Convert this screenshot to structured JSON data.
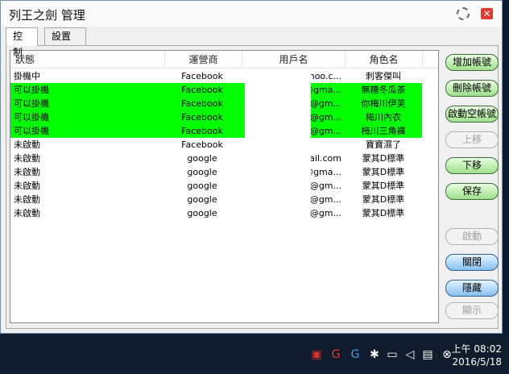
{
  "window": {
    "title": "列王之劍 管理"
  },
  "icons": {
    "settings": "gear-icon",
    "close": "close-icon"
  },
  "tabs": [
    {
      "label": "控制",
      "active": true
    },
    {
      "label": "設置",
      "active": false
    }
  ],
  "table": {
    "columns": [
      "狀態",
      "運營商",
      "用戶名",
      "角色名"
    ],
    "rows": [
      {
        "status": "掛機中",
        "provider": "Facebook",
        "user": "hoo.c...",
        "role": "刺客傑叫",
        "highlight": false
      },
      {
        "status": "可以掛機",
        "provider": "Facebook",
        "user": "@gma...",
        "role": "無糖冬瓜茶",
        "highlight": true
      },
      {
        "status": "可以掛機",
        "provider": "Facebook",
        "user": "@gm...",
        "role": "你梅川伊芙",
        "highlight": true
      },
      {
        "status": "可以掛機",
        "provider": "Facebook",
        "user": "@gm...",
        "role": "梅川內衣",
        "highlight": true
      },
      {
        "status": "可以掛機",
        "provider": "Facebook",
        "user": "@gm...",
        "role": "梅川三角褲",
        "highlight": true
      },
      {
        "status": "未啟動",
        "provider": "Facebook",
        "user": "",
        "role": "寶寶濕了",
        "highlight": false
      },
      {
        "status": "未啟動",
        "provider": "google",
        "user": "mail.com",
        "role": "蒙其D標準",
        "highlight": false
      },
      {
        "status": "未啟動",
        "provider": "google",
        "user": "@gma...",
        "role": "蒙其D標準",
        "highlight": false
      },
      {
        "status": "未啟動",
        "provider": "google",
        "user": "@gm...",
        "role": "蒙其D標準",
        "highlight": false
      },
      {
        "status": "未啟動",
        "provider": "google",
        "user": "@gm...",
        "role": "蒙其D標準",
        "highlight": false
      },
      {
        "status": "未啟動",
        "provider": "google",
        "user": "@gm...",
        "role": "蒙其D標準",
        "highlight": false
      }
    ]
  },
  "buttons": [
    {
      "label": "增加帳號",
      "style": "green",
      "enabled": true
    },
    {
      "label": "刪除帳號",
      "style": "green",
      "enabled": true
    },
    {
      "label": "啟動空帳號",
      "style": "green",
      "enabled": true
    },
    {
      "label": "上移",
      "style": "disabled",
      "enabled": false
    },
    {
      "label": "下移",
      "style": "green",
      "enabled": true
    },
    {
      "label": "保存",
      "style": "green",
      "enabled": true
    },
    {
      "label": "啟動",
      "style": "disabled",
      "enabled": false
    },
    {
      "label": "關閉",
      "style": "blue",
      "enabled": true
    },
    {
      "label": "隱藏",
      "style": "blue",
      "enabled": true
    },
    {
      "label": "顯示",
      "style": "disabled",
      "enabled": false
    }
  ],
  "taskbar": {
    "tray_icons": [
      "game-icon",
      "gi-icon",
      "logitech-icon",
      "bluetooth-icon",
      "network-icon",
      "volume-icon",
      "notification-icon",
      "close-circle-icon"
    ],
    "time": "上午 08:02",
    "date": "2016/5/18"
  },
  "colors": {
    "highlight": "#00ff00",
    "taskbar": "#101b2d"
  }
}
